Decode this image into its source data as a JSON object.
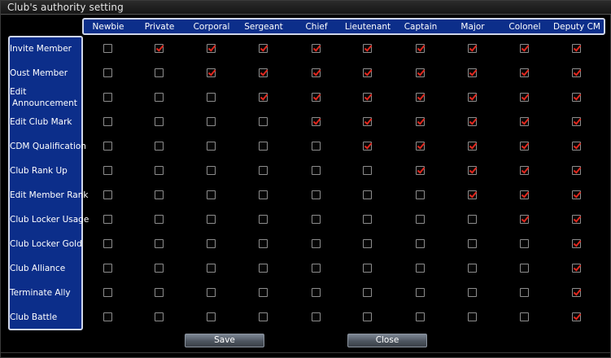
{
  "window": {
    "title": "Club's authority setting"
  },
  "columns": [
    "Newbie",
    "Private",
    "Corporal",
    "Sergeant",
    "Chief",
    "Lieutenant",
    "Captain",
    "Major",
    "Colonel",
    "Deputy CM"
  ],
  "rows": [
    {
      "label": "Invite Member",
      "checks": [
        false,
        true,
        true,
        true,
        true,
        true,
        true,
        true,
        true,
        true
      ]
    },
    {
      "label": "Oust Member",
      "checks": [
        false,
        false,
        true,
        true,
        true,
        true,
        true,
        true,
        true,
        true
      ]
    },
    {
      "label": "Edit\nAnnouncement",
      "checks": [
        false,
        false,
        false,
        true,
        true,
        true,
        true,
        true,
        true,
        true
      ]
    },
    {
      "label": "Edit Club Mark",
      "checks": [
        false,
        false,
        false,
        false,
        true,
        true,
        true,
        true,
        true,
        true
      ]
    },
    {
      "label": "CDM Qualification",
      "checks": [
        false,
        false,
        false,
        false,
        false,
        true,
        true,
        true,
        true,
        true
      ]
    },
    {
      "label": "Club Rank Up",
      "checks": [
        false,
        false,
        false,
        false,
        false,
        false,
        true,
        true,
        true,
        true
      ]
    },
    {
      "label": "Edit Member Rank",
      "checks": [
        false,
        false,
        false,
        false,
        false,
        false,
        false,
        true,
        true,
        true
      ]
    },
    {
      "label": "Club Locker Usage",
      "checks": [
        false,
        false,
        false,
        false,
        false,
        false,
        false,
        false,
        true,
        true
      ]
    },
    {
      "label": "Club Locker Gold",
      "checks": [
        false,
        false,
        false,
        false,
        false,
        false,
        false,
        false,
        false,
        true
      ]
    },
    {
      "label": "Club Alliance",
      "checks": [
        false,
        false,
        false,
        false,
        false,
        false,
        false,
        false,
        false,
        true
      ]
    },
    {
      "label": "Terminate Ally",
      "checks": [
        false,
        false,
        false,
        false,
        false,
        false,
        false,
        false,
        false,
        true
      ]
    },
    {
      "label": "Club Battle",
      "checks": [
        false,
        false,
        false,
        false,
        false,
        false,
        false,
        false,
        false,
        true
      ]
    }
  ],
  "buttons": {
    "save": "Save",
    "close": "Close"
  },
  "colors": {
    "panel_blue": "#0c2e8a",
    "check_red": "#e0281e",
    "panel_border": "#cfd6ea"
  }
}
